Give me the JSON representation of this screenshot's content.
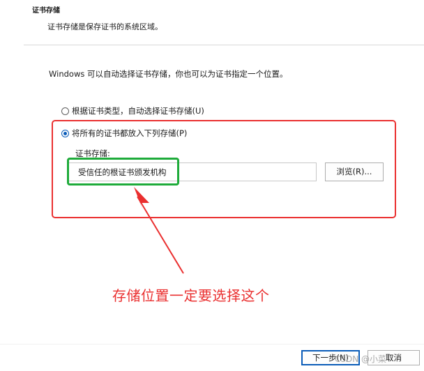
{
  "wizard": {
    "heading": "证书存储",
    "subheading": "证书存储是保存证书的系统区域。",
    "intro": "Windows 可以自动选择证书存储，你也可以为证书指定一个位置。"
  },
  "options": {
    "auto_label": "根据证书类型，自动选择证书存储(U)",
    "place_label": "将所有的证书都放入下列存储(P)",
    "selected": "place"
  },
  "store": {
    "label": "证书存储:",
    "value": "受信任的根证书颁发机构",
    "browse_label": "浏览(R)..."
  },
  "annotation": {
    "text": "存储位置一定要选择这个",
    "color": "#ea2f2f",
    "highlight_color": "#1eab3a"
  },
  "footer": {
    "next_label": "下一步(N)",
    "cancel_label": "取消"
  },
  "watermark": {
    "text": "CSDN @小菜"
  },
  "colors": {
    "accent": "#0a5cb8",
    "annotation_red": "#ea2f2f",
    "annotation_green": "#1eab3a"
  }
}
